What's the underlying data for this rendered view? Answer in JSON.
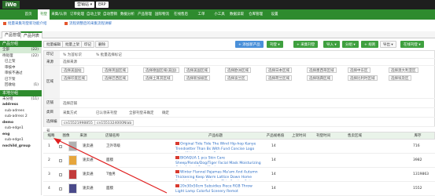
{
  "topbar": {
    "logo": "iWe",
    "select1": "营销站 ▾",
    "select2": "ERP"
  },
  "nav": {
    "items": [
      "首页",
      "刊登",
      "采集/认领",
      "订单处理",
      "自动上架",
      "自动营销",
      "数据分析",
      "产品管理",
      "国际物流",
      "在线售后",
      "工单",
      "小工具",
      "数据读取",
      "仓库管理",
      "设置"
    ],
    "active_index": 1
  },
  "notices": [
    "批量采集刊登新功能介绍",
    "流程调整后的采集流程讲解"
  ],
  "tabs": [
    "产品管理",
    "产品列表"
  ],
  "sidebar": {
    "title": "产品分组",
    "items": [
      {
        "label": "全部",
        "count": "(22)",
        "style": "sel"
      },
      {
        "label": "待处理",
        "count": "(22)",
        "style": ""
      },
      {
        "label": "已上架",
        "count": "",
        "style": "sub"
      },
      {
        "label": "审核中",
        "count": "",
        "style": "sub"
      },
      {
        "label": "审核不通过",
        "count": "",
        "style": "sub"
      },
      {
        "label": "已下架",
        "count": "",
        "style": "sub"
      },
      {
        "label": "回收站",
        "count": "(1)",
        "style": "sub"
      }
    ],
    "group_title": "本地分组",
    "groups": [
      {
        "label": "未分组",
        "count": "(11)",
        "style": ""
      },
      {
        "label": "address",
        "count": "",
        "style": "bold"
      },
      {
        "label": "sub-adrees",
        "count": "",
        "style": "sub"
      },
      {
        "label": "sub-adress 2",
        "count": "",
        "style": "sub"
      },
      {
        "label": "demo",
        "count": "",
        "style": "bold"
      },
      {
        "label": "sub-edge1",
        "count": "",
        "style": "sub"
      },
      {
        "label": "eng",
        "count": "",
        "style": "bold"
      },
      {
        "label": "sub-edge1",
        "count": "",
        "style": "sub"
      },
      {
        "label": "nochild_group",
        "count": "",
        "style": "bold"
      }
    ]
  },
  "toolbar": {
    "left": [
      "批量编辑",
      "批量上架",
      "印记",
      "删除"
    ],
    "right": [
      "+ 添加新产品",
      "刊登 ▾",
      "+ 采集刊登",
      "导入 ▾",
      "分组 ▾",
      "+ 规则",
      "导出 ▾",
      "在线刊登 ▾"
    ]
  },
  "filters": {
    "row1": {
      "label": "印记",
      "chips": [
        "% 为首标识",
        "% 批量选择标记"
      ]
    },
    "row2": {
      "label": "来源",
      "chips": [
        "选择来源"
      ]
    },
    "row3": {
      "label": "区域",
      "chips": [
        "选择美国站",
        "选择英国区域",
        "选择德国区域(美国)",
        "选择美国区域",
        "选择欧洲区域",
        "选择日本区域",
        "选择墨西哥区域",
        "选择中东区",
        "选择澳大利亚区",
        "选择印度区域",
        "选择巴西区域",
        "选择土耳其区域",
        "选择新加坡区",
        "选择波兰区",
        "选择荷兰区域",
        "选择瑞典区域",
        "选择比利时区域",
        "选择埃及区"
      ]
    },
    "row4": {
      "label": "店铺",
      "chips": [
        "选择店铺"
      ]
    },
    "row5": {
      "label": "类目",
      "chips": [
        "采集方式",
        "已认领未刊登",
        "全部刊登未确定",
        "确定"
      ]
    },
    "row6": {
      "label": "选择编号",
      "chips": [
        "cn15521998855",
        "cn1551324000Nlab"
      ]
    }
  },
  "table": {
    "headers": [
      "缩略",
      "图像",
      "来源",
      "店铺名称",
      "产品标题",
      "产品规格值",
      "上架时间",
      "刊登时间",
      "售卖区域",
      "库存"
    ],
    "rows": [
      {
        "source": "速卖通",
        "shop": "卫外等级",
        "title": "Original Tide Tide The Wind Hip-hop Kanye Trendsetter Than Bs With Fund Concise Logo Even Midnight Loose Coat",
        "spec": "14",
        "stock": "716",
        "thumb_color": "#b0b0b0"
      },
      {
        "source": "速卖通",
        "shop": "面膜",
        "title": "BIOAQUA 1 pcs Skin Care Sheep/Panda/Dog/Tiger Facial Mask Moisturizing Cute Animal Face Masks",
        "spec": "14",
        "stock": "3982",
        "thumb_color": "#e6a63c"
      },
      {
        "source": "速卖通",
        "shop": "T恤男",
        "title": "Winter Flannel Pajamas Ma'am And Autumn Thickening Keep Warm Lattice Down Home Furnishing Serve Pullover Thin Section Suit",
        "spec": "14",
        "stock": "1319863",
        "thumb_color": "#c23b3b"
      },
      {
        "source": "速卖通",
        "shop": "面膜",
        "title": "20x30x50cm Subsidies Piece RGB Throw Light Lamp Colorful Scenery Remot",
        "spec": "14",
        "stock": "1552",
        "thumb_color": "#4a4a8a"
      }
    ]
  },
  "colors": {
    "nav_green": "#2e8b2e",
    "link_blue": "#2d6ec5",
    "arrow_red": "#e02020"
  }
}
